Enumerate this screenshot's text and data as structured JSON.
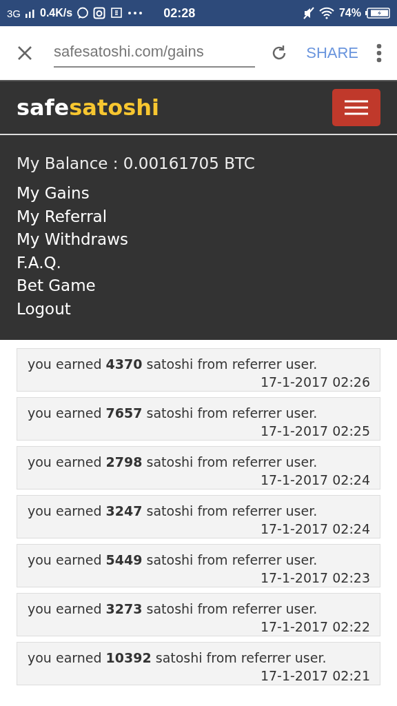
{
  "status_bar": {
    "network": "3G",
    "speed": "0.4K/s",
    "time": "02:28",
    "battery": "74%"
  },
  "browser": {
    "url": "safesatoshi.com/gains",
    "share": "SHARE"
  },
  "header": {
    "logo_first": "safe",
    "logo_second": "satoshi"
  },
  "menu": {
    "balance": "My Balance : 0.00161705 BTC",
    "items": [
      "My Gains",
      "My Referral",
      "My Withdraws",
      "F.A.Q.",
      "Bet Game",
      "Logout"
    ]
  },
  "logs": [
    {
      "message": "you earned **4370** satoshi from referrer user.",
      "time": "17-1-2017 02:26"
    },
    {
      "message": "you earned **7657** satoshi from referrer user.",
      "time": "17-1-2017 02:25"
    },
    {
      "message": "you earned **2798** satoshi from referrer user.",
      "time": "17-1-2017 02:24"
    },
    {
      "message": "you earned **3247** satoshi from referrer user.",
      "time": "17-1-2017 02:24"
    },
    {
      "message": "you earned **5449** satoshi from referrer user.",
      "time": "17-1-2017 02:23"
    },
    {
      "message": "you earned **3273** satoshi from referrer user.",
      "time": "17-1-2017 02:22"
    },
    {
      "message": "you earned **10392** satoshi from referrer user.",
      "time": "17-1-2017 02:21"
    }
  ]
}
